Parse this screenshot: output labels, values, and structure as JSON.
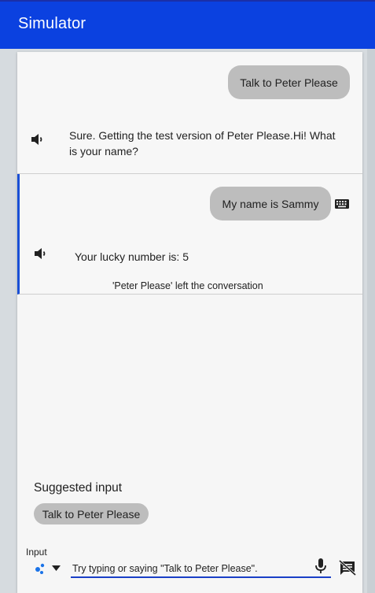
{
  "header": {
    "title": "Simulator",
    "color": "#0b41e0"
  },
  "conversation": {
    "turns": [
      {
        "user": "Talk to Peter Please",
        "agent": "Sure. Getting the test version of Peter Please.Hi! What is your name?"
      },
      {
        "user": "My name is Sammy",
        "user_input_icon": "keyboard-icon",
        "agent": "Your lucky number is: 5",
        "note": "'Peter Please' left the conversation"
      }
    ]
  },
  "suggested": {
    "title": "Suggested input",
    "chips": [
      "Talk to Peter Please"
    ]
  },
  "input": {
    "label": "Input",
    "placeholder": "Try typing or saying \"Talk to Peter Please\".",
    "accent": "#1a3fc7"
  }
}
